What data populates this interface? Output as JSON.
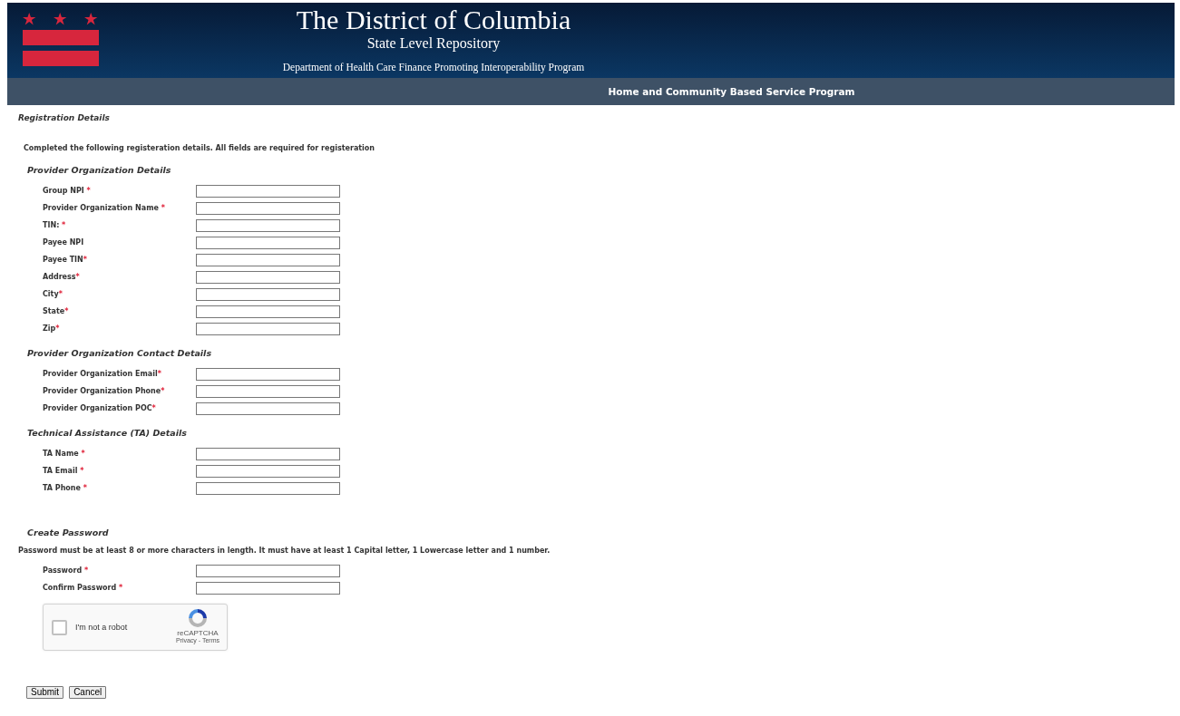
{
  "header": {
    "title": "The District of Columbia",
    "subtitle": "State Level Repository",
    "tagline": "Department of Health Care Finance Promoting Interoperability Program"
  },
  "nav_bar": {
    "title": "Home and Community Based Service Program"
  },
  "page_title": "Registration Details",
  "intro": "Completed the following registeration details. All fields are required for registeration",
  "sections": [
    {
      "title": "Provider Organization Details",
      "fields": [
        {
          "label": "Group NPI",
          "required_mark": " *"
        },
        {
          "label": "Provider Organization Name",
          "required_mark": " *"
        },
        {
          "label": "TIN:",
          "required_mark": " *"
        },
        {
          "label": "Payee NPI"
        },
        {
          "label": "Payee TIN",
          "required_mark": "*"
        },
        {
          "label": "Address",
          "required_mark": "*"
        },
        {
          "label": "City",
          "required_mark": "*"
        },
        {
          "label": "State",
          "required_mark": "*"
        },
        {
          "label": "Zip",
          "required_mark": "*"
        }
      ]
    },
    {
      "title": "Provider Organization Contact Details",
      "fields": [
        {
          "label": "Provider Organization Email",
          "required_mark": "*"
        },
        {
          "label": "Provider Organization Phone",
          "required_mark": "*"
        },
        {
          "label": "Provider Organization POC",
          "required_mark": "*"
        }
      ]
    },
    {
      "title": "Technical Assistance (TA) Details",
      "fields": [
        {
          "label": "TA Name",
          "required_mark": " *"
        },
        {
          "label": "TA Email",
          "required_mark": " *"
        },
        {
          "label": "TA Phone",
          "required_mark": " *"
        }
      ]
    }
  ],
  "password_section": {
    "title": "Create Password",
    "note": "Password must be at least 8 or more characters in length. It must have at least 1 Capital letter, 1 Lowercase letter and 1 number.",
    "fields": [
      {
        "label": "Password",
        "required_mark": " *"
      },
      {
        "label": "Confirm Password",
        "required_mark": " *"
      }
    ]
  },
  "captcha": {
    "label": "I'm not a robot",
    "checked": false,
    "brand": "reCAPTCHA",
    "links": "Privacy - Terms"
  },
  "buttons": [
    "Submit",
    "Cancel"
  ]
}
